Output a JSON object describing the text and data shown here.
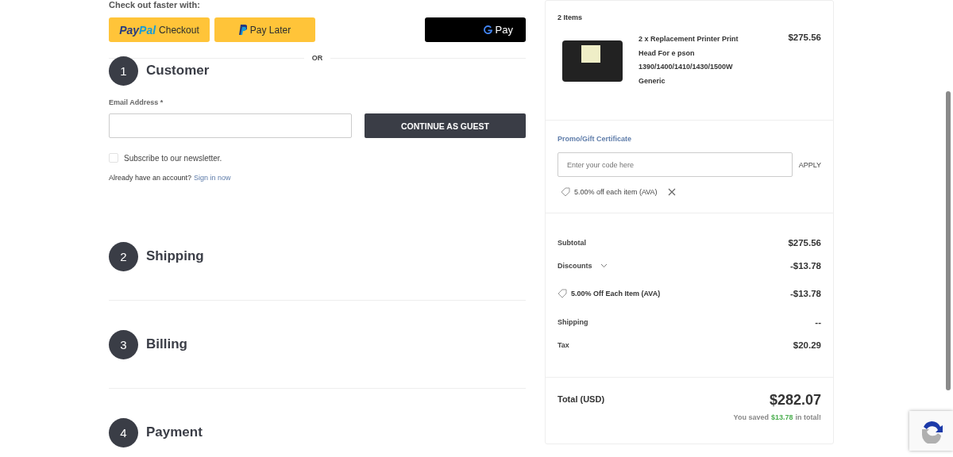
{
  "express_checkout": {
    "heading": "Check out faster with:",
    "buttons": [
      {
        "kind": "paypal",
        "brand": "PayPal",
        "label": "Checkout"
      },
      {
        "kind": "paylater",
        "label": "Pay Later"
      },
      {
        "kind": "gpay",
        "label": "Pay"
      }
    ],
    "separator": "OR"
  },
  "steps": [
    {
      "number": "1",
      "title": "Customer"
    },
    {
      "number": "2",
      "title": "Shipping"
    },
    {
      "number": "3",
      "title": "Billing"
    },
    {
      "number": "4",
      "title": "Payment"
    }
  ],
  "customer_form": {
    "email_label": "Email Address *",
    "continue_button": "CONTINUE AS GUEST",
    "newsletter": {
      "label": "Subscribe to our newsletter.",
      "checked": false
    },
    "account_prompt": "Already have an account?",
    "sign_in_link": "Sign in now"
  },
  "order_summary": {
    "items_heading": "2 Items",
    "items": [
      {
        "name_lines": [
          "2 x Replacement Printer Print",
          "Head For e pson",
          "1390/1400/1410/1430/1500W",
          "Generic"
        ],
        "price": "$275.56"
      }
    ],
    "promo": {
      "link": "Promo/Gift Certificate",
      "placeholder": "Enter your code here",
      "apply": "APPLY",
      "applied": [
        {
          "label": "5.00% off each item (AVA)"
        }
      ]
    },
    "totals": [
      {
        "kind": "line",
        "label": "Subtotal",
        "value": "$275.56"
      },
      {
        "kind": "discounts",
        "label": "Discounts",
        "value": "-$13.78",
        "expanded": true,
        "children": [
          {
            "label": "5.00% Off Each Item (AVA)",
            "value": "-$13.78"
          }
        ]
      },
      {
        "kind": "line",
        "label": "Shipping",
        "value": "--"
      },
      {
        "kind": "line",
        "label": "Tax",
        "value": "$20.29"
      }
    ],
    "grand_total": {
      "label": "Total (USD)",
      "value": "$282.07",
      "savings": {
        "before": "You saved",
        "amount": "$13.78",
        "after": "in total!"
      }
    }
  }
}
